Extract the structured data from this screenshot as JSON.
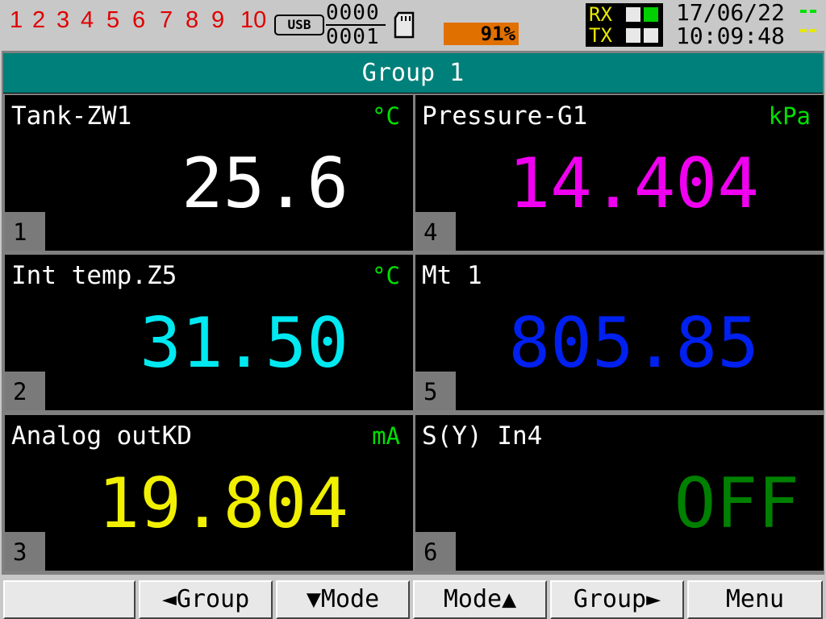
{
  "status_bar": {
    "channels": [
      "1",
      "2",
      "3",
      "4",
      "5",
      "6",
      "7",
      "8",
      "9",
      "10"
    ],
    "usb_label": "USB",
    "counter_top": "0000",
    "counter_bottom": "0001",
    "card_icon": "sd-card-icon",
    "capacity": "91%",
    "rx_label": "RX",
    "tx_label": "TX",
    "date": "17/06/22",
    "time": "10:09:48"
  },
  "group": {
    "title": "Group 1"
  },
  "panels": [
    {
      "tag": "Tank-ZW1",
      "unit": "°C",
      "value": "25.6",
      "channel": "1",
      "color": "#ffffff"
    },
    {
      "tag": "Int temp.Z5",
      "unit": "°C",
      "value": "31.50",
      "channel": "2",
      "color": "#00e8f0"
    },
    {
      "tag": "Analog outKD",
      "unit": "mA",
      "value": "19.804",
      "channel": "3",
      "color": "#f0f000"
    },
    {
      "tag": "Pressure-G1",
      "unit": "kPa",
      "value": "14.404",
      "channel": "4",
      "color": "#f000f0"
    },
    {
      "tag": "Mt 1",
      "unit": "",
      "value": "805.85",
      "channel": "5",
      "color": "#0020f0"
    },
    {
      "tag": "S(Y) In4",
      "unit": "",
      "value": "OFF",
      "channel": "6",
      "color": "#008000"
    }
  ],
  "softkeys": [
    "",
    "◄Group",
    "▼Mode",
    "Mode▲",
    "Group►",
    "Menu"
  ],
  "colors": {
    "accent": "#00807a",
    "channel_numbers": "#e00000",
    "capacity": "#e07000",
    "unit": "#00e000"
  }
}
